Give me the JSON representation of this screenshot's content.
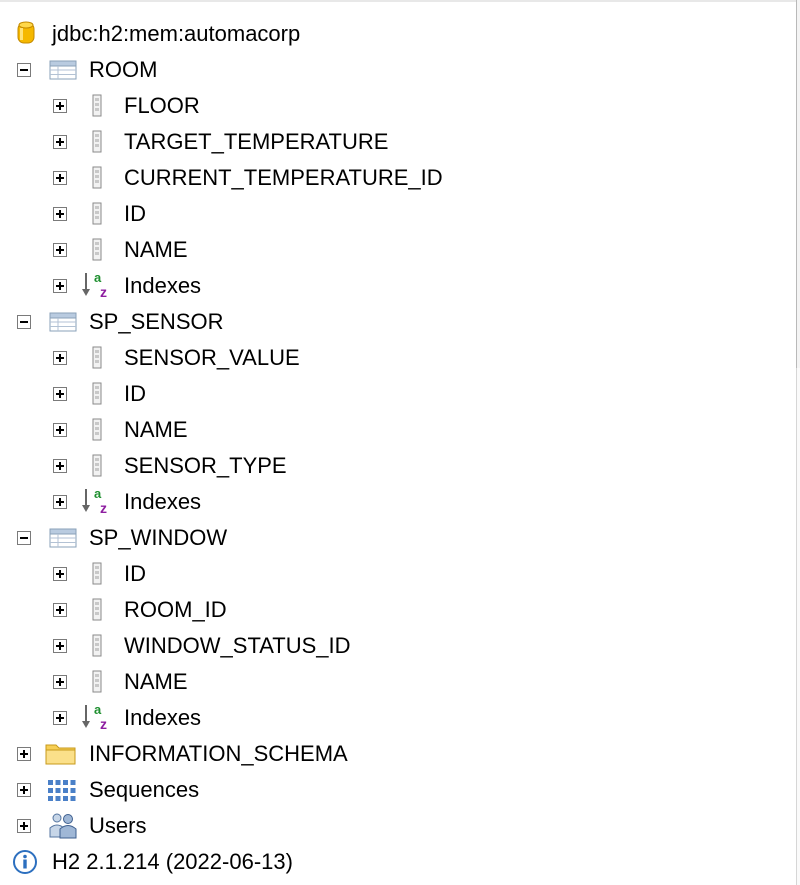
{
  "tree": {
    "connection": {
      "label": "jdbc:h2:mem:automacorp",
      "icon": "database-icon"
    },
    "tables": [
      {
        "name": "ROOM",
        "columns": [
          "FLOOR",
          "TARGET_TEMPERATURE",
          "CURRENT_TEMPERATURE_ID",
          "ID",
          "NAME"
        ],
        "indexes_label": "Indexes"
      },
      {
        "name": "SP_SENSOR",
        "columns": [
          "SENSOR_VALUE",
          "ID",
          "NAME",
          "SENSOR_TYPE"
        ],
        "indexes_label": "Indexes"
      },
      {
        "name": "SP_WINDOW",
        "columns": [
          "ID",
          "ROOM_ID",
          "WINDOW_STATUS_ID",
          "NAME"
        ],
        "indexes_label": "Indexes"
      }
    ],
    "schema": {
      "label": "INFORMATION_SCHEMA",
      "icon": "folder-icon"
    },
    "sequences": {
      "label": "Sequences",
      "icon": "sequences-icon"
    },
    "users": {
      "label": "Users",
      "icon": "users-icon"
    },
    "version": {
      "label": "H2 2.1.214 (2022-06-13)",
      "icon": "info-icon"
    }
  }
}
